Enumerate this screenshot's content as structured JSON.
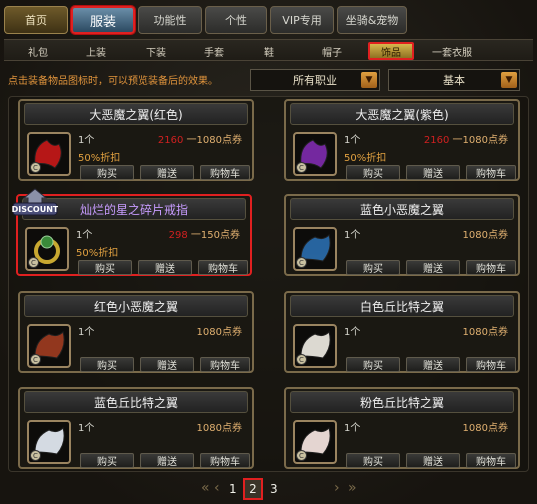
{
  "top_tabs": [
    {
      "label": "首页"
    },
    {
      "label": "服装"
    },
    {
      "label": "功能性"
    },
    {
      "label": "个性"
    },
    {
      "label": "VIP专用"
    },
    {
      "label": "坐骑&宠物"
    }
  ],
  "sub_tabs": [
    {
      "label": "礼包"
    },
    {
      "label": "上装"
    },
    {
      "label": "下装"
    },
    {
      "label": "手套"
    },
    {
      "label": "鞋"
    },
    {
      "label": "帽子"
    },
    {
      "label": "饰品"
    },
    {
      "label": "一套衣服"
    }
  ],
  "hint": "点击装备物品图标时，可以预览装备后的效果。",
  "filters": {
    "job": "所有职业",
    "sort": "基本"
  },
  "badge": "DISCOUNT",
  "coin": "C",
  "items": [
    {
      "name": "大恶魔之翼(红色)",
      "qty": "1个",
      "old_price": "2160",
      "price_sep": " 一",
      "price": "1080点券",
      "discount": "50%折扣",
      "buy": "购买",
      "gift": "赠送",
      "cart": "购物车",
      "color": "#c01818"
    },
    {
      "name": "大恶魔之翼(紫色)",
      "qty": "1个",
      "old_price": "2160",
      "price_sep": " 一",
      "price": "1080点券",
      "discount": "50%折扣",
      "buy": "购买",
      "gift": "赠送",
      "cart": "购物车",
      "color": "#7a2aa8"
    },
    {
      "name": "灿烂的星之碎片戒指",
      "qty": "1个",
      "old_price": "298",
      "price_sep": " 一",
      "price": "150点券",
      "discount": "50%折扣",
      "buy": "购买",
      "gift": "赠送",
      "cart": "购物车",
      "color": "#3a8a3a"
    },
    {
      "name": "蓝色小恶魔之翼",
      "qty": "1个",
      "old_price": "",
      "price_sep": "",
      "price": "1080点券",
      "discount": "",
      "buy": "购买",
      "gift": "赠送",
      "cart": "购物车",
      "color": "#2a6aa8"
    },
    {
      "name": "红色小恶魔之翼",
      "qty": "1个",
      "old_price": "",
      "price_sep": "",
      "price": "1080点券",
      "discount": "",
      "buy": "购买",
      "gift": "赠送",
      "cart": "购物车",
      "color": "#9a3a20"
    },
    {
      "name": "白色丘比特之翼",
      "qty": "1个",
      "old_price": "",
      "price_sep": "",
      "price": "1080点券",
      "discount": "",
      "buy": "购买",
      "gift": "赠送",
      "cart": "购物车",
      "color": "#e8e4dc"
    },
    {
      "name": "蓝色丘比特之翼",
      "qty": "1个",
      "old_price": "",
      "price_sep": "",
      "price": "1080点券",
      "discount": "",
      "buy": "购买",
      "gift": "赠送",
      "cart": "购物车",
      "color": "#dfe6ee"
    },
    {
      "name": "粉色丘比特之翼",
      "qty": "1个",
      "old_price": "",
      "price_sep": "",
      "price": "1080点券",
      "discount": "",
      "buy": "购买",
      "gift": "赠送",
      "cart": "购物车",
      "color": "#f0e0dc"
    }
  ],
  "pagination": {
    "pages": [
      "1",
      "2",
      "3"
    ],
    "current": "2",
    "prev": "‹",
    "prev_double": "«",
    "next": "›",
    "next_double": "»"
  }
}
